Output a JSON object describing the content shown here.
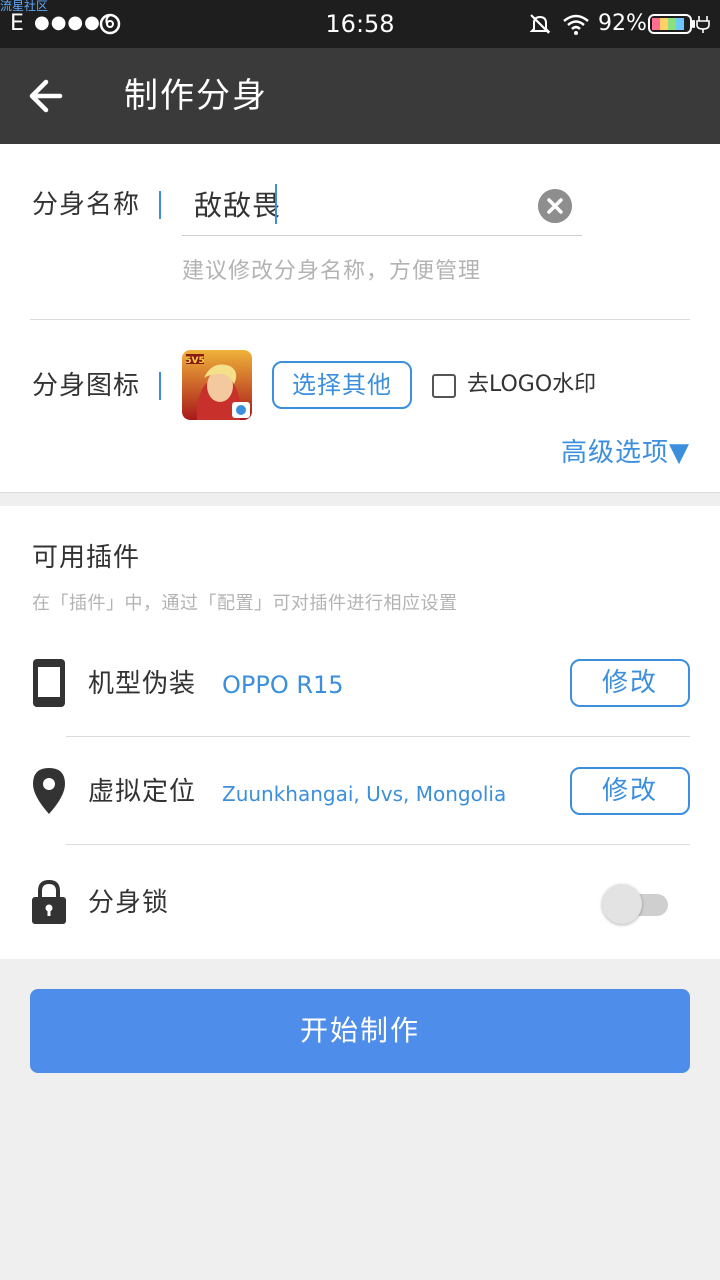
{
  "status_bar": {
    "watermark": "流星社区",
    "network": "E",
    "signal": "●●●●",
    "time": "16:58",
    "battery_percent": "92%"
  },
  "toolbar": {
    "title": "制作分身"
  },
  "clone_name": {
    "label": "分身名称",
    "value": "敌敌畏",
    "hint": "建议修改分身名称，方便管理"
  },
  "clone_icon": {
    "label": "分身图标",
    "select_button": "选择其他",
    "remove_logo_label": "去LOGO水印",
    "remove_logo_checked": false,
    "advanced_options": "高级选项▼"
  },
  "plugins": {
    "title": "可用插件",
    "subtitle": "在「插件」中，通过「配置」可对插件进行相应设置",
    "items": [
      {
        "label": "机型伪装",
        "value": "OPPO R15",
        "button": "修改"
      },
      {
        "label": "虚拟定位",
        "value": "Zuunkhangai, Uvs, Mongolia",
        "button": "修改"
      },
      {
        "label": "分身锁",
        "enabled": false
      }
    ]
  },
  "start_button": "开始制作",
  "colors": {
    "accent": "#3b8fdc",
    "primary_button": "#4f8dea",
    "toolbar": "#3a3a3a"
  }
}
